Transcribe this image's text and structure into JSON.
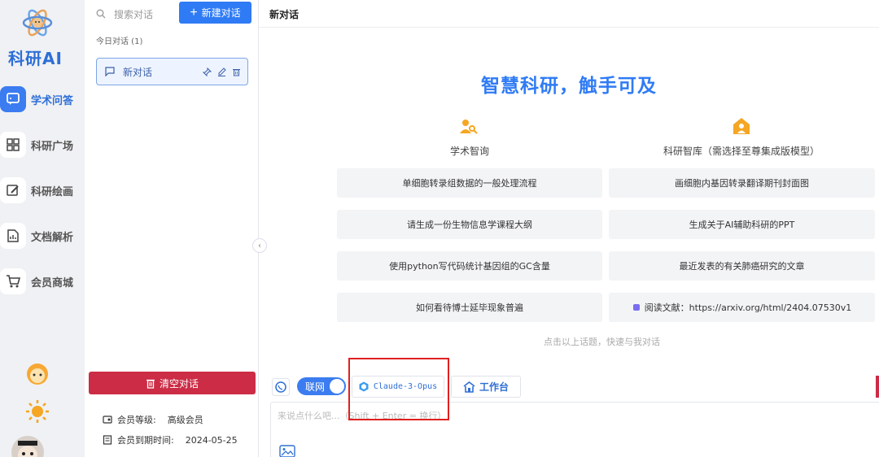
{
  "brand": {
    "name": "科研AI"
  },
  "rail": {
    "items": [
      {
        "label": "学术问答",
        "icon": "chat-square-icon"
      },
      {
        "label": "科研广场",
        "icon": "grid-icon"
      },
      {
        "label": "科研绘画",
        "icon": "paint-icon"
      },
      {
        "label": "文档解析",
        "icon": "document-icon"
      },
      {
        "label": "会员商城",
        "icon": "cart-icon"
      }
    ]
  },
  "panel": {
    "search_placeholder": "搜索对话",
    "new_chat": "新建对话",
    "today_group": "今日对话  (1)",
    "conversation": "新对话",
    "clear": "清空对话",
    "member_level_label": "会员等级:",
    "member_level": "高级会员",
    "member_expire_label": "会员到期时间:",
    "member_expire": "2024-05-25"
  },
  "main": {
    "title": "新对话",
    "hero": "智慧科研，触手可及",
    "col_left": "学术智询",
    "col_right": "科研智库（需选择至尊集成版模型）",
    "cards_left": [
      "单细胞转录组数据的一般处理流程",
      "请生成一份生物信息学课程大纲",
      "使用python写代码统计基因组的GC含量",
      "如何看待博士延毕现象普遍"
    ],
    "cards_right": [
      "画细胞内基因转录翻译期刊封面图",
      "生成关于AI辅助科研的PPT",
      "最近发表的有关肺癌研究的文章",
      "阅读文献：https://arxiv.org/html/2404.07530v1"
    ],
    "hint": "点击以上话题，快速与我对话",
    "net_label": "联网",
    "model": "Claude-3-Opus",
    "workbench": "工作台",
    "input_placeholder": "来说点什么吧...（Shift + Enter = 换行）"
  },
  "colors": {
    "accent": "#2f7bf5",
    "danger": "#cc2c45",
    "highlight": "#e02020"
  }
}
